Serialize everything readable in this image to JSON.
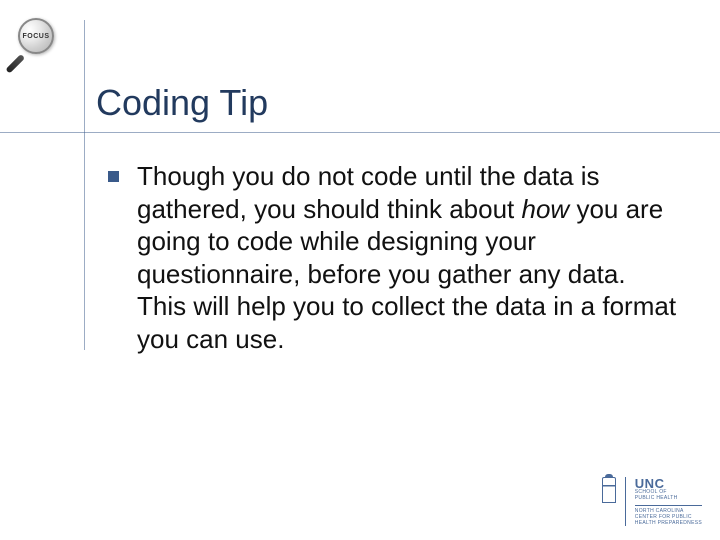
{
  "logo": {
    "label": "FOCUS"
  },
  "slide": {
    "title": "Coding Tip",
    "bullet": {
      "part1": "Though you do not code until the data is gathered, you should think about ",
      "italic": "how",
      "part2": " you are going to code while designing your questionnaire, before you gather any data.  This will help you to collect the data in a format you can use."
    }
  },
  "footer": {
    "org_main": "UNC",
    "org_sub1": "SCHOOL OF",
    "org_sub2": "PUBLIC HEALTH",
    "center1": "NORTH CAROLINA",
    "center2": "CENTER FOR PUBLIC",
    "center3": "HEALTH PREPAREDNESS"
  }
}
